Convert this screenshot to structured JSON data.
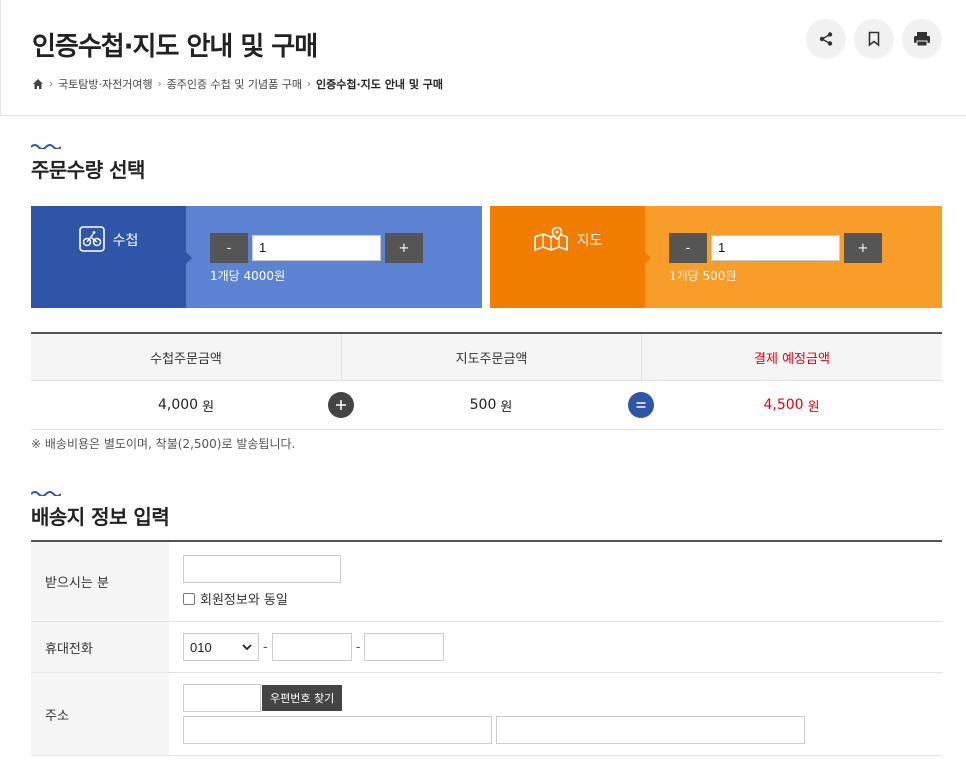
{
  "header": {
    "title": "인증수첩·지도 안내 및 구매",
    "breadcrumb": [
      "국토탐방·자전거여행",
      "종주인증 수첩 및 기념품 구매",
      "인증수첩·지도 안내 및 구매"
    ],
    "icons": [
      "share-icon",
      "bookmark-icon",
      "print-icon"
    ]
  },
  "sections": {
    "order_title": "주문수량 선택",
    "shipping_title": "배송지 정보 입력"
  },
  "passbook": {
    "label": "수첩",
    "quantity": "1",
    "minus": "-",
    "plus": "+",
    "unit_price": "1개당 4000원",
    "color_dark": "#2e55a8",
    "color_light": "#5b83d1"
  },
  "map": {
    "label": "지도",
    "quantity": "1",
    "minus": "-",
    "plus": "+",
    "unit_price": "1개당 500원",
    "color_dark": "#f07c00",
    "color_light": "#f89c2a"
  },
  "summary": {
    "headers": [
      "수첩주문금액",
      "지도주문금액",
      "결제 예정금액"
    ],
    "passbook_amount": "4,000",
    "map_amount": "500",
    "total_amount": "4,500",
    "unit": "원",
    "plus_op": "+",
    "equals_op": "=",
    "note": "※ 배송비용은 별도이며, 착불(2,500)로 발송됩니다."
  },
  "shipping": {
    "recipient_label": "받으시는 분",
    "same_as_member": "회원정보와 동일",
    "phone_label": "휴대전화",
    "phone_prefix": "010",
    "phone_sep": "-",
    "address_label": "주소",
    "zip_button": "우편번호 찾기"
  }
}
